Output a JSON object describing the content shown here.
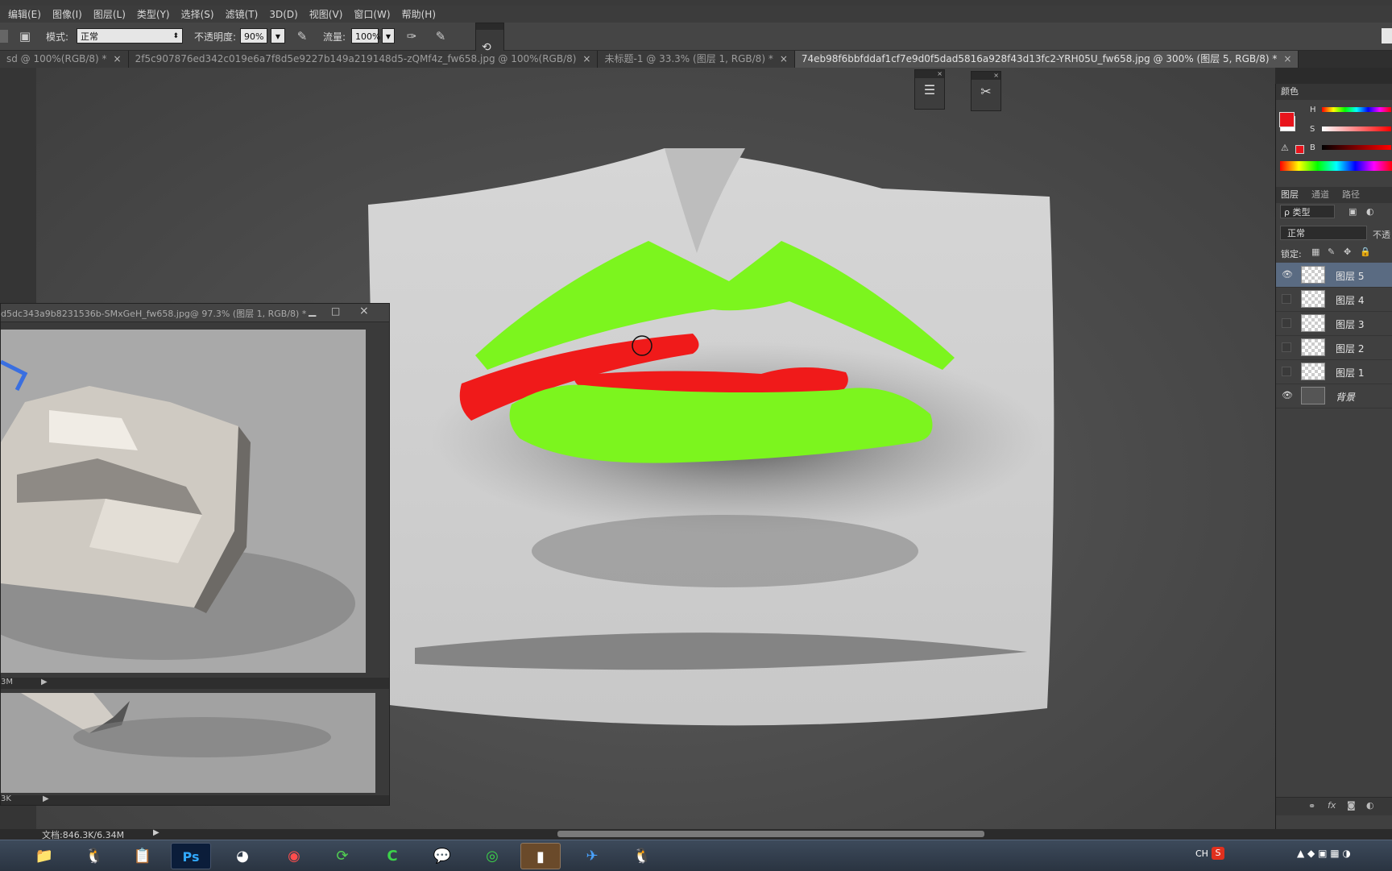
{
  "menu": {
    "items": [
      "编辑(E)",
      "图像(I)",
      "图层(L)",
      "类型(Y)",
      "选择(S)",
      "滤镜(T)",
      "3D(D)",
      "视图(V)",
      "窗口(W)",
      "帮助(H)"
    ]
  },
  "options": {
    "mode_label": "模式:",
    "mode_value": "正常",
    "opacity_label": "不透明度:",
    "opacity_value": "90%",
    "flow_label": "流量:",
    "flow_value": "100%"
  },
  "tabs": [
    {
      "label": "sd @ 100%(RGB/8) *",
      "active": false
    },
    {
      "label": "2f5c907876ed342c019e6a7f8d5e9227b149a219148d5-zQMf4z_fw658.jpg @ 100%(RGB/8)",
      "active": false
    },
    {
      "label": "未标题-1 @ 33.3% (图层 1, RGB/8) *",
      "active": false
    },
    {
      "label": "74eb98f6bbfddaf1cf7e9d0f5dad5816a928f43d13fc2-YRH05U_fw658.jpg @ 300% (图层 5, RGB/8) *",
      "active": true
    }
  ],
  "floating_doc": {
    "title": "d5dc343a9b8231536b-SMxGeH_fw658.jpg@ 97.3% (图层 1, RGB/8) *",
    "zoom_status": "3M",
    "bottom_status": "3K"
  },
  "color_panel": {
    "title": "颜色",
    "h_label": "H",
    "s_label": "S",
    "b_label": "B",
    "foreground": "#e8141c",
    "background": "#ffffff"
  },
  "layers_panel": {
    "tabs": [
      "图层",
      "通道",
      "路径"
    ],
    "filter_label": "ρ 类型",
    "blend_mode": "正常",
    "opacity_short": "不透",
    "lock_label": "锁定:",
    "layers": [
      {
        "name": "图层 5",
        "visible": true,
        "selected": true
      },
      {
        "name": "图层 4",
        "visible": false,
        "selected": false
      },
      {
        "name": "图层 3",
        "visible": false,
        "selected": false
      },
      {
        "name": "图层 2",
        "visible": false,
        "selected": false
      },
      {
        "name": "图层 1",
        "visible": false,
        "selected": false
      },
      {
        "name": "背景",
        "visible": true,
        "selected": false
      }
    ]
  },
  "status": {
    "doc_size": "文档:846.3K/6.34M"
  },
  "taskbar": {
    "lang": "CH"
  },
  "colors": {
    "lip_green": "#7cf51e",
    "lip_red": "#f01a1a"
  }
}
